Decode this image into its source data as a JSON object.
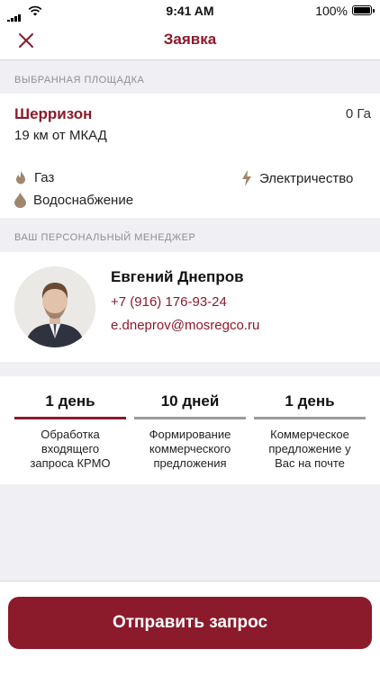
{
  "status_bar": {
    "time": "9:41 AM",
    "battery": "100%"
  },
  "nav": {
    "title": "Заявка"
  },
  "venue_section": {
    "label": "ВЫБРАННАЯ ПЛОЩАДКА"
  },
  "venue": {
    "name": "Шерризон",
    "size": "0 Га",
    "distance": "19 км от МКАД",
    "features": {
      "gas": "Газ",
      "electricity": "Электричество",
      "water": "Водоснабжение"
    }
  },
  "manager_section": {
    "label": "ВАШ ПЕРСОНАЛЬНЫЙ МЕНЕДЖЕР"
  },
  "manager": {
    "name": "Евгений Днепров",
    "phone": "+7 (916) 176-93-24",
    "email": "e.dneprov@mosregco.ru"
  },
  "steps": [
    {
      "duration": "1 день",
      "line1": "Обработка",
      "line2": "входящего",
      "line3": "запроса КРМО"
    },
    {
      "duration": "10 дней",
      "line1": "Формирование",
      "line2": "коммерческого",
      "line3": "предложения"
    },
    {
      "duration": "1 день",
      "line1": "Коммерческое",
      "line2": "предложение у",
      "line3": "Вас на почте"
    }
  ],
  "submit_label": "Отправить запрос",
  "colors": {
    "accent": "#8b1a2b",
    "background": "#efeff4",
    "inactive_line": "#9a9a9e"
  },
  "icons": {
    "close": "close-icon",
    "gas": "flame-icon",
    "electricity": "lightning-icon",
    "water": "water-drop-icon"
  }
}
